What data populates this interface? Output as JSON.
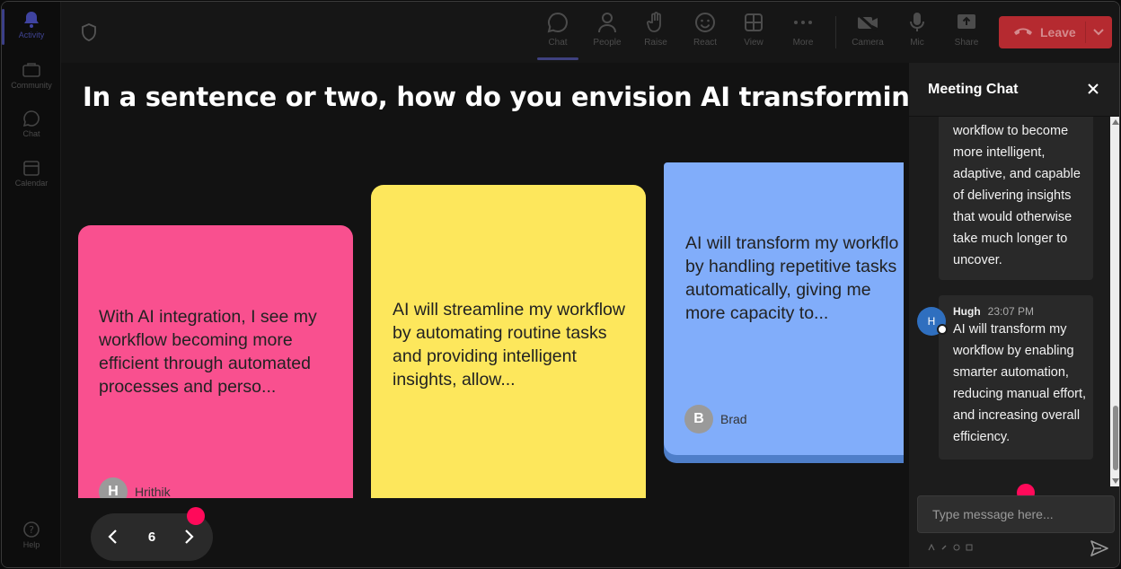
{
  "rail": {
    "items": [
      {
        "label": "Activity",
        "icon": "bell-icon"
      },
      {
        "label": "Community",
        "icon": "community-icon"
      },
      {
        "label": "Chat",
        "icon": "chat-icon"
      },
      {
        "label": "Calendar",
        "icon": "calendar-icon"
      },
      {
        "label": "Help",
        "icon": "help-icon"
      }
    ]
  },
  "toolbar": {
    "chat": "Chat",
    "people": "People",
    "raise": "Raise",
    "react": "React",
    "view": "View",
    "more": "More",
    "camera": "Camera",
    "mic": "Mic",
    "share": "Share",
    "leave": "Leave"
  },
  "question": "In a sentence or two, how do you envision AI transforming your current workflow?",
  "cards": [
    {
      "text": "With AI integration, I see my workflow becoming more efficient through automated processes and perso...",
      "author": "Hrithik",
      "initial": "H",
      "color": "#f9508f"
    },
    {
      "text": "AI will streamline my workflow by automating routine tasks and providing intelligent insights, allow...",
      "author": "",
      "initial": "",
      "color": "#fde75c"
    },
    {
      "text": "AI will transform my workflow by handling repetitive tasks automatically, giving me more capacity to...",
      "author": "Brad",
      "initial": "B",
      "color": "#81adfa"
    }
  ],
  "pager": {
    "current": "6"
  },
  "chat": {
    "title": "Meeting Chat",
    "messages": [
      {
        "author": "",
        "time": "",
        "text": "workflow to become more intelligent, adaptive, and capable of delivering insights that would otherwise take much longer to uncover."
      },
      {
        "author": "Hugh",
        "time": "23:07 PM",
        "initial": "H",
        "text": "AI will transform my workflow by enabling smarter automation, reducing manual effort, and increasing overall efficiency."
      }
    ],
    "input_placeholder": "Type message here..."
  },
  "colors": {
    "accent": "#5b5fc7",
    "leave": "#b52a30",
    "pink_dot": "#ff0a5a"
  }
}
